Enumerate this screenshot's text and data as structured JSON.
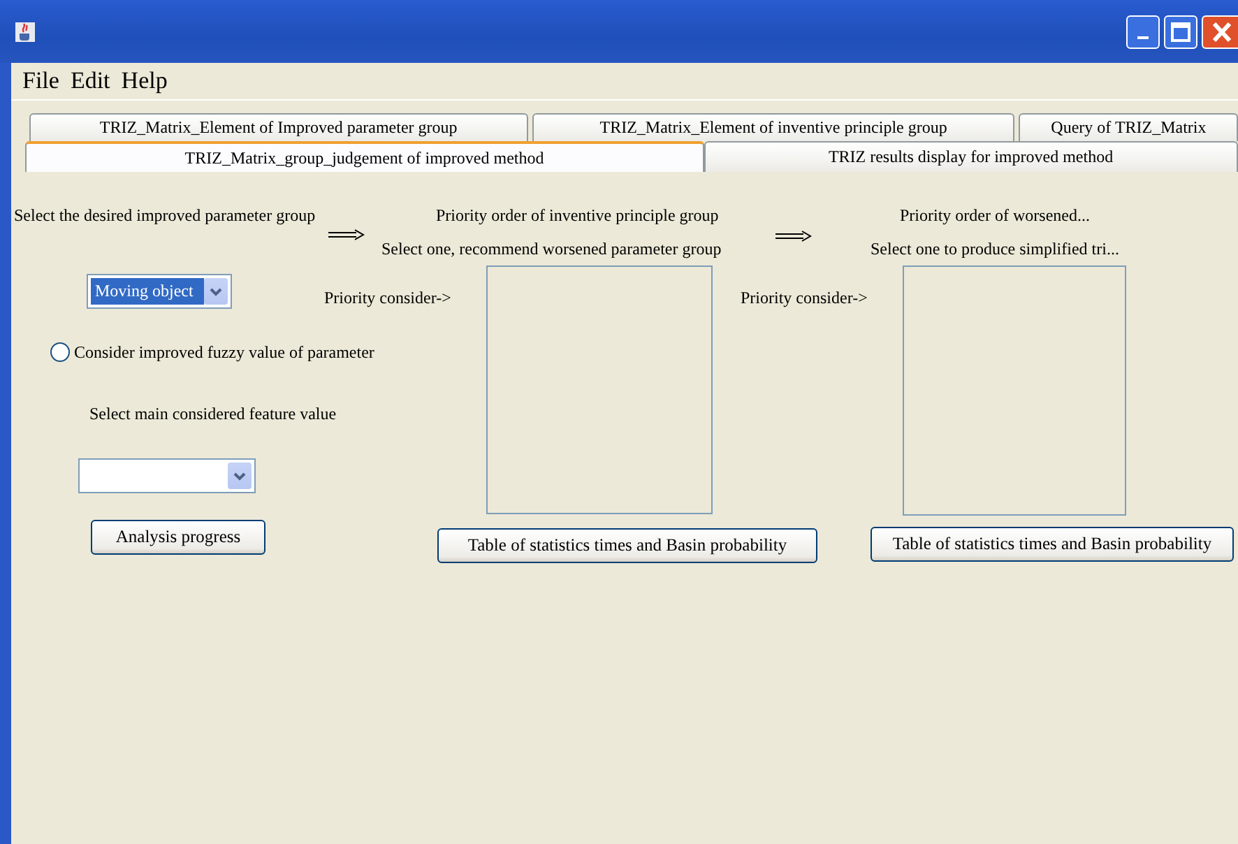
{
  "menu": [
    "File",
    "Edit",
    "Help"
  ],
  "tab_rows": [
    {
      "tabs": [
        {
          "label": "TRIZ_Matrix_Element of Improved parameter group",
          "selected": false
        },
        {
          "label": "TRIZ_Matrix_Element of inventive principle group",
          "selected": false
        },
        {
          "label": "Query of TRIZ_Matrix",
          "selected": false
        }
      ]
    },
    {
      "tabs": [
        {
          "label": "TRIZ_Matrix_group_judgement of improved method",
          "selected": true
        },
        {
          "label": "TRIZ results display for improved method",
          "selected": false
        }
      ]
    }
  ],
  "group_panel": {
    "label": "Select the desired improved parameter group",
    "combo": {
      "value": "Moving object",
      "focused": true
    },
    "radio": {
      "label": "Consider improved fuzzy value of parameter",
      "selected": false
    },
    "feature_label": "Select main considered feature value",
    "button": "Analysis progress"
  },
  "principle_panel": {
    "title": "Priority order of inventive principle group",
    "subtitle": "Select one, recommend worsened parameter group",
    "list_label": "Priority consider->",
    "button": "Table of statistics times and Basin probability"
  },
  "worsened_panel": {
    "title": "Priority order of worsened...",
    "subtitle": "Select one to produce simplified tri...",
    "list_label": "Priority consider->",
    "button": "Table of statistics times and Basin probability"
  }
}
